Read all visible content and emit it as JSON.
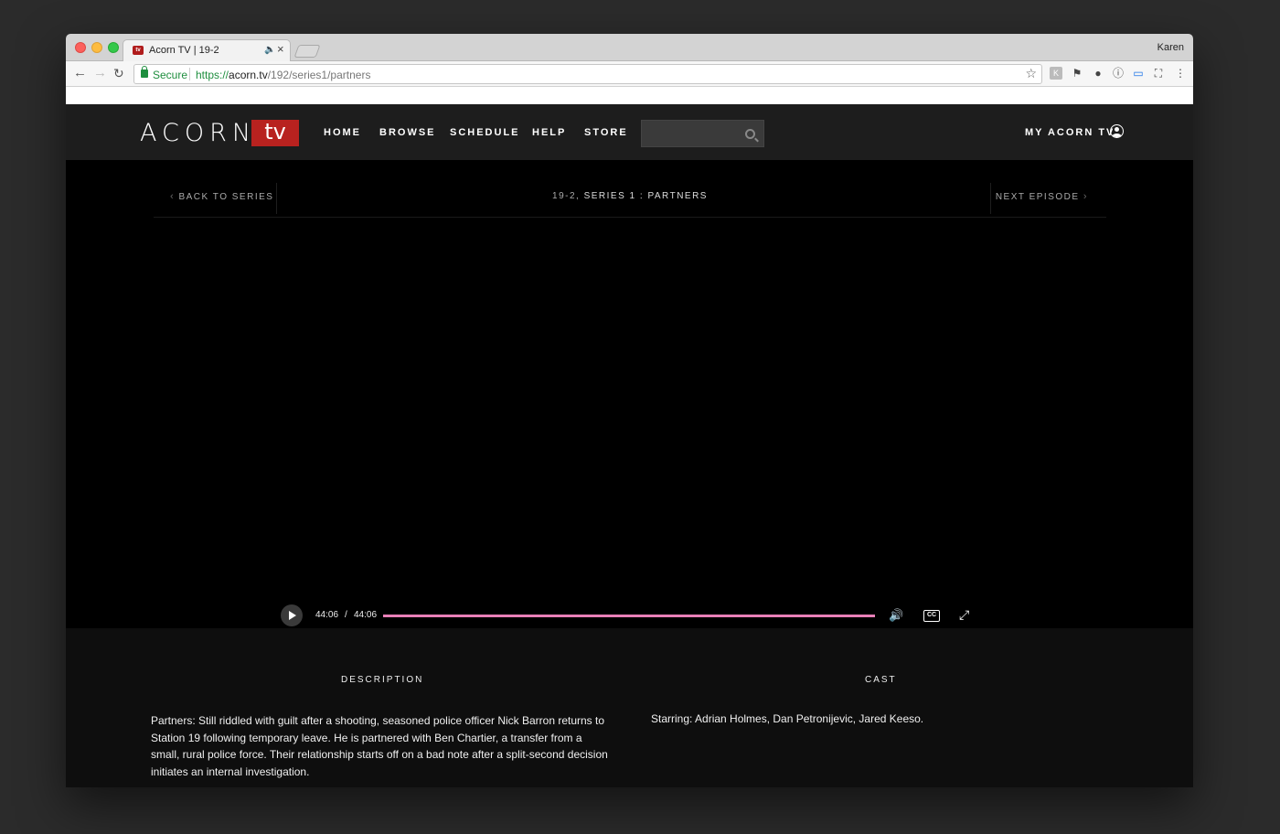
{
  "browser": {
    "tab_title": "Acorn TV | 19-2",
    "tab_favicon": "tv",
    "tab_audio_icon": "🔈",
    "tab_close_icon": "×",
    "profile_name": "Karen",
    "secure_label": "Secure",
    "url_scheme": "https://",
    "url_host": "acorn.tv",
    "url_path": "/192/series1/partners",
    "nav_back": "←",
    "nav_forward": "→",
    "nav_reload": "↻",
    "star": "☆",
    "extension_labels": [
      "K",
      "⚑",
      "●",
      "ⓘ",
      "▭",
      "⛶",
      "⋮"
    ]
  },
  "site": {
    "logo_text": "ACORN",
    "logo_badge": "tv",
    "menu": [
      "HOME",
      "BROWSE",
      "SCHEDULE",
      "HELP",
      "STORE"
    ],
    "search_placeholder": "",
    "account_label": "MY ACORN TV"
  },
  "episode_nav": {
    "back_label": "BACK TO SERIES",
    "back_chevron": "‹",
    "title_show": "19-2,",
    "title_series": "SERIES 1 : PARTNERS",
    "next_label": "NEXT EPISODE",
    "next_chevron": "›"
  },
  "player": {
    "current_time": "44:06",
    "separator": "/",
    "duration": "44:06",
    "progress_fraction": 1.0,
    "volume_icon": "🔊",
    "cc_label": "CC",
    "fullscreen_icon": "⤢",
    "progress_color": "#e880b8"
  },
  "info": {
    "description_heading": "DESCRIPTION",
    "description_text": "Partners: Still riddled with guilt after a shooting, seasoned police officer Nick Barron returns to Station 19 following temporary leave. He is partnered with Ben Chartier, a transfer from a small, rural police force. Their relationship starts off on a bad note after a split-second decision initiates an internal investigation.",
    "cast_heading": "CAST",
    "cast_text": "Starring: Adrian Holmes, Dan Petronijevic, Jared Keeso."
  }
}
